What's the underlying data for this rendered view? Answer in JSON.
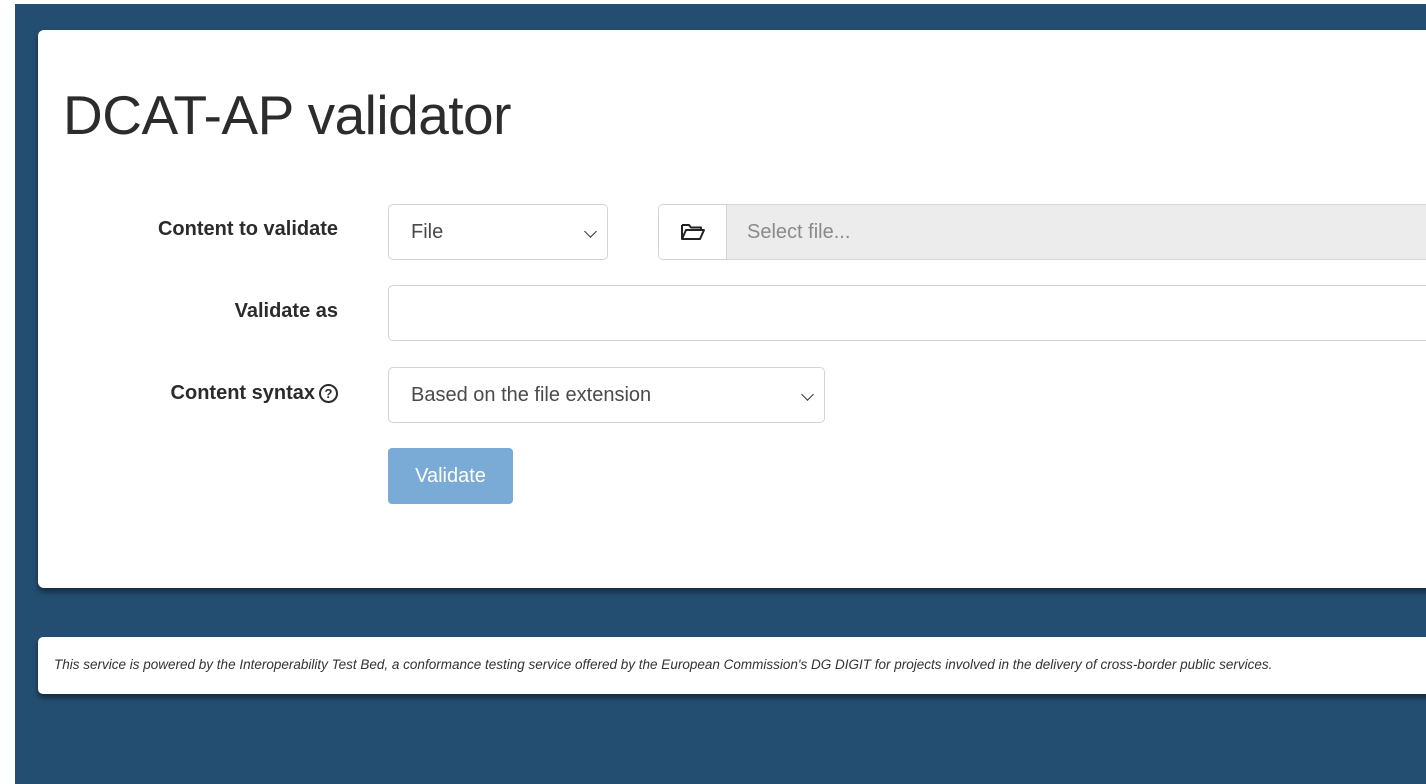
{
  "page": {
    "title": "DCAT-AP validator"
  },
  "form": {
    "content_label": "Content to validate",
    "content_type_value": "File",
    "file_placeholder": "Select file...",
    "validate_as_label": "Validate as",
    "validate_as_value": "",
    "syntax_label": "Content syntax",
    "syntax_help_icon": "question-circle-icon",
    "syntax_value": "Based on the file extension",
    "validate_button": "Validate"
  },
  "footer": {
    "text": "This service is powered by the Interoperability Test Bed, a conformance testing service offered by the European Commission's DG DIGIT for projects involved in the delivery of cross-border public services."
  },
  "colors": {
    "background": "#234e72",
    "button": "#7aaad6",
    "card": "#ffffff"
  }
}
